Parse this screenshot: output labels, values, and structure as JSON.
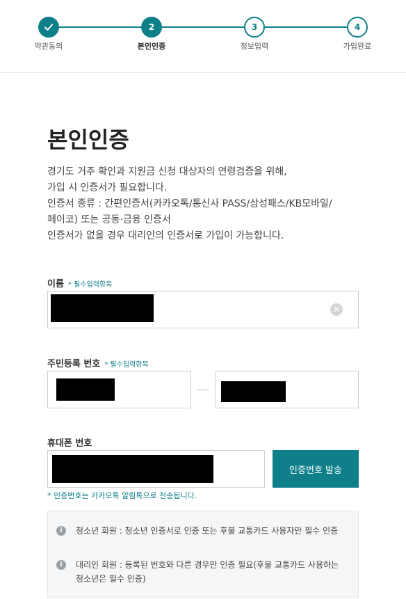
{
  "stepper": {
    "steps": [
      {
        "label": "약관동의",
        "number": "",
        "state": "done"
      },
      {
        "label": "본인인증",
        "number": "2",
        "state": "active"
      },
      {
        "label": "정보입력",
        "number": "3",
        "state": "todo"
      },
      {
        "label": "가입완료",
        "number": "4",
        "state": "todo"
      }
    ]
  },
  "main": {
    "title": "본인인증",
    "description": [
      "경기도 거주 확인과 지원금 신청 대상자의 연령검증을 위해,",
      "가입 시 인증서가 필요합니다.",
      "인증서 종류 : 간편인증서(카카오톡/통신사 PASS/삼성패스/KB모바일/",
      "페이코) 또는 공동·금융 인증서",
      "인증서가 없을 경우 대리인의 인증서로 가입이 가능합니다."
    ]
  },
  "form": {
    "name": {
      "label": "이름",
      "required": "* 필수입력항목"
    },
    "rrn": {
      "label": "주민등록 번호",
      "required": "* 필수입력항목"
    },
    "phone": {
      "label": "휴대폰 번호"
    },
    "send_button": "인증번호 발송",
    "hint": "* 인증번호는 카카오톡 알림톡으로 전송됩니다."
  },
  "notice": {
    "items": [
      "청소년 회원 : 청소년 인증서로 인증 또는 후불 교통카드 사용자만 필수 인증",
      "대리인 회원 : 등록된 번호와 다른 경우만 인증 필요(후불 교통카드 사용하는 청소년은 필수 인증)"
    ]
  },
  "colors": {
    "accent": "#0f7f89"
  },
  "icons": {
    "done": "check-icon",
    "clear": "clear-icon",
    "info": "info-icon"
  }
}
